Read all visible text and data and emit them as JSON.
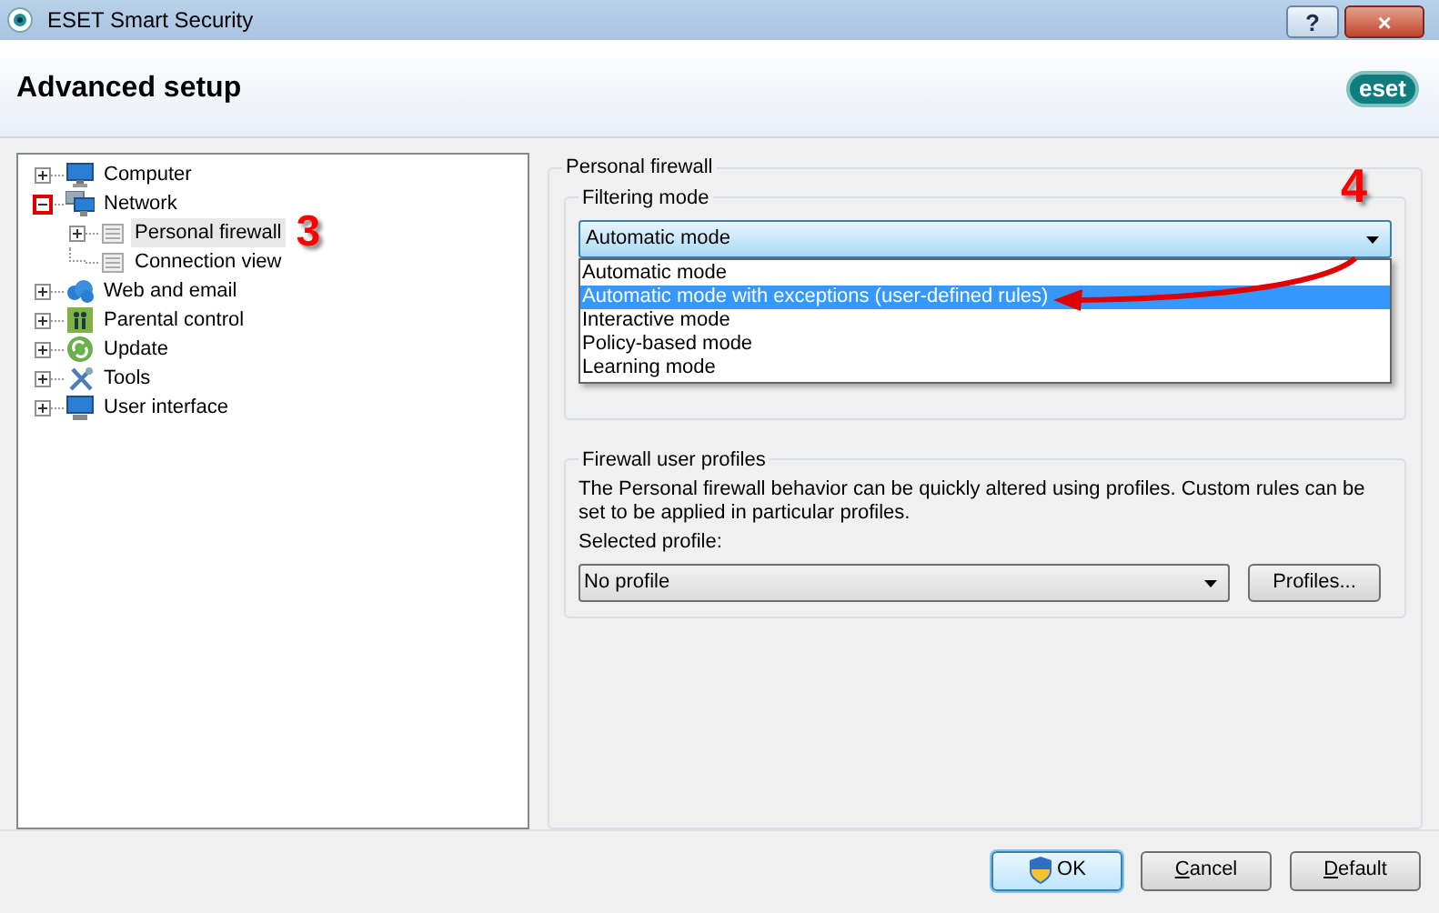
{
  "window": {
    "title": "ESET Smart Security",
    "buttons": [
      "?",
      "×"
    ]
  },
  "header": {
    "title": "Advanced setup",
    "logo": "eset"
  },
  "tree": [
    {
      "label": "Computer",
      "expanded": false,
      "marked": false,
      "selected": false
    },
    {
      "label": "Network",
      "expanded": true,
      "marked": true,
      "selected": false,
      "children": [
        {
          "label": "Personal firewall",
          "expanded": false,
          "selected": true
        },
        {
          "label": "Connection view",
          "selected": false
        }
      ]
    },
    {
      "label": "Web and email",
      "expanded": false,
      "marked": false,
      "selected": false
    },
    {
      "label": "Parental control",
      "expanded": false,
      "marked": false,
      "selected": false
    },
    {
      "label": "Update",
      "expanded": false,
      "marked": false,
      "selected": false
    },
    {
      "label": "Tools",
      "expanded": false,
      "marked": false,
      "selected": false
    },
    {
      "label": "User interface",
      "expanded": false,
      "marked": false,
      "selected": false
    }
  ],
  "annotations": [
    "3",
    "4"
  ],
  "firewall": {
    "title": "Personal firewall",
    "filtering": {
      "title": "Filtering mode",
      "value": "Automatic mode",
      "expanded": true,
      "options": [
        {
          "label": "Automatic mode",
          "highlighted": false
        },
        {
          "label": "Automatic mode with exceptions (user-defined rules)",
          "highlighted": true
        },
        {
          "label": "Interactive mode",
          "highlighted": false
        },
        {
          "label": "Policy-based mode",
          "highlighted": false
        },
        {
          "label": "Learning mode",
          "highlighted": false
        }
      ]
    },
    "profiles": {
      "title": "Firewall user profiles",
      "description": "The Personal firewall behavior can be quickly altered using profiles. Custom rules can be set to be applied in particular profiles.",
      "field_label": "Selected profile:",
      "value": "No profile",
      "button": "Profiles..."
    }
  },
  "buttons": [
    {
      "label": "OK",
      "default": true,
      "underline_first": false
    },
    {
      "label": "Cancel",
      "default": false,
      "underline_first": true
    },
    {
      "label": "Default",
      "default": false,
      "underline_first": true
    }
  ]
}
